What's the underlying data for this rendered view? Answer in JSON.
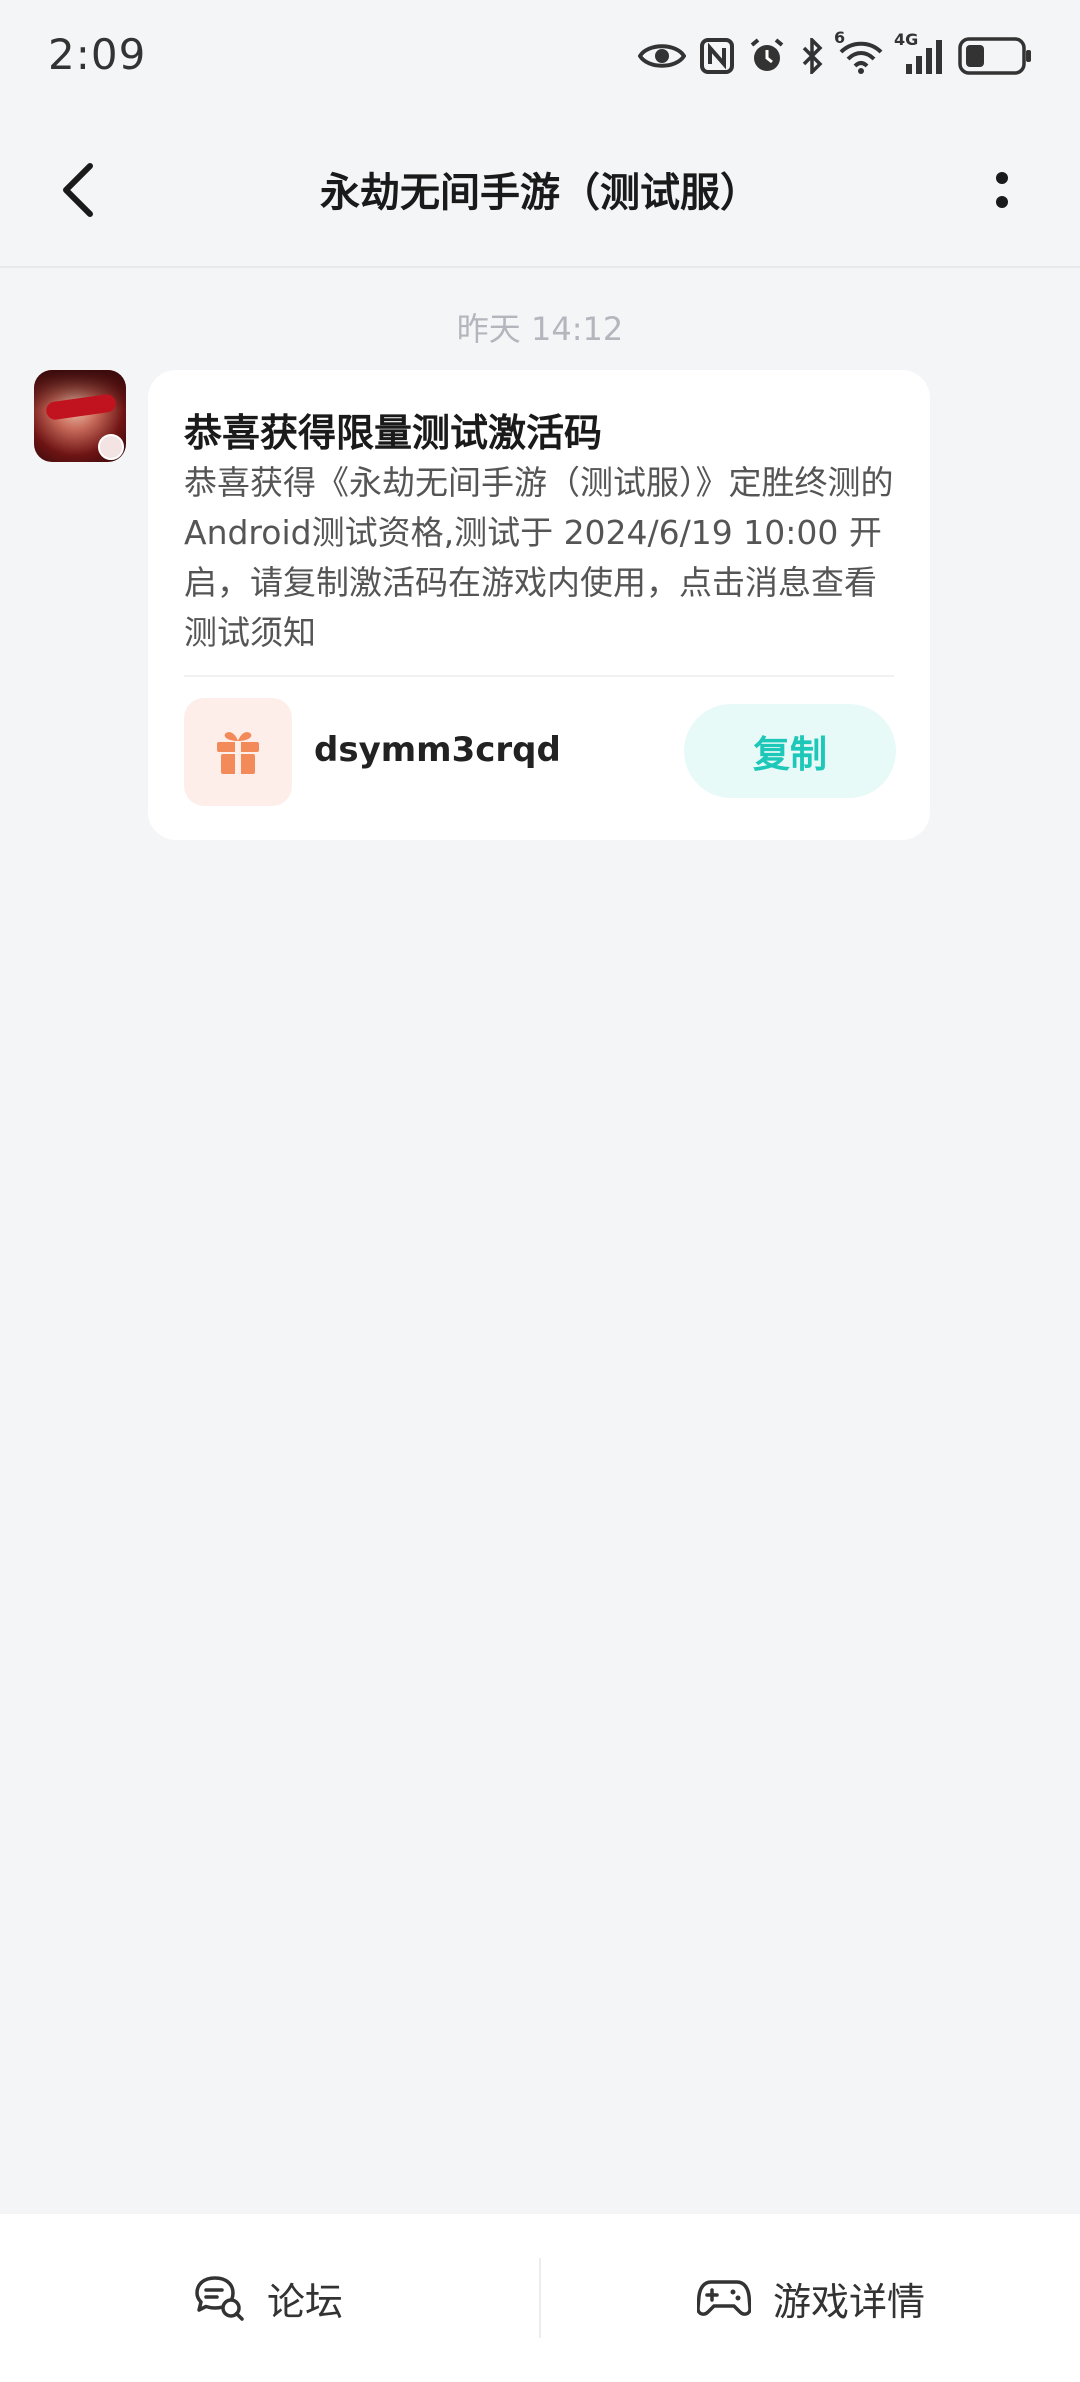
{
  "status_bar": {
    "time": "2:09",
    "icons": [
      "eye-icon",
      "nfc-icon",
      "alarm-icon",
      "bluetooth-icon",
      "wifi-icon",
      "signal-4g-icon",
      "battery-icon"
    ],
    "network_label": "4G",
    "wifi_label": "6"
  },
  "header": {
    "title": "永劫无间手游（测试服）",
    "back_icon": "chevron-left-icon",
    "more_icon": "more-vertical-icon"
  },
  "chat": {
    "timestamp": "昨天  14:12",
    "message": {
      "title": "恭喜获得限量测试激活码",
      "body": "恭喜获得《永劫无间手游（测试服）》定胜终测的Android测试资格,测试于 2024/6/19 10:00 开启，请复制激活码在游戏内使用，点击消息查看测试须知",
      "code": "dsymm3crqd",
      "copy_label": "复制",
      "gift_icon": "gift-icon"
    }
  },
  "bottom_bar": {
    "forum_label": "论坛",
    "game_details_label": "游戏详情"
  },
  "colors": {
    "accent": "#1ec8b8",
    "copy_bg": "#e7faf8",
    "gift": "#f28a5a",
    "gift_bg": "#fdeeea",
    "page_bg": "#f4f5f7"
  }
}
